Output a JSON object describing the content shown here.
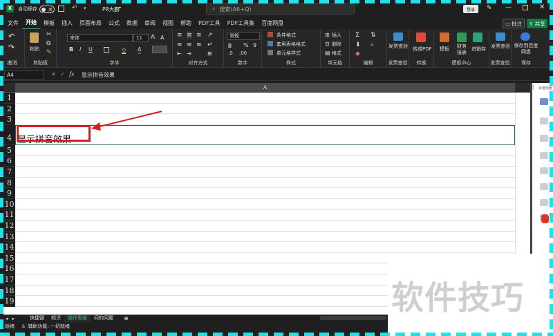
{
  "title_bar": {
    "autosave_label": "自动保存",
    "autosave_state": "关",
    "file_name": "PR大鹏",
    "search_placeholder": "搜索(Alt+Q)",
    "login_label": "登录"
  },
  "menu": [
    "文件",
    "开始",
    "模板",
    "插入",
    "页面布局",
    "公式",
    "数据",
    "审阅",
    "视图",
    "帮助",
    "PDF工具",
    "PDF工具集",
    "百度网盘"
  ],
  "active_menu": "开始",
  "header_buttons": {
    "comment": "批注",
    "share": "共享"
  },
  "ribbon": {
    "undo_label": "撤消",
    "clipboard_label": "剪贴板",
    "paste_label": "粘贴",
    "font_label": "字体",
    "font_name": "宋体",
    "font_size": "11",
    "alignment_label": "对齐方式",
    "number_label": "数字",
    "number_format": "常规",
    "styles_label": "样式",
    "style_items": [
      "条件格式",
      "套用表格格式",
      "单元格样式"
    ],
    "cells_label": "单元格",
    "cell_items": [
      "插入",
      "删除",
      "格式"
    ],
    "edit_label": "编辑",
    "invoice_label": "发票查验",
    "invoice_btn": "发票查验",
    "convert_label": "转换",
    "convert_btn": "转成PDF",
    "template_center_label": "模板中心",
    "template_btn": "模板",
    "finance_btn": "财务报表",
    "sales_btn": "进销存",
    "invoice2_label": "发票查验",
    "invoice2_btn": "发票查验",
    "save_label": "保存",
    "save_btn": "保存到百度网盘"
  },
  "formula_bar": {
    "name_box": "A4",
    "formula": "显示拼音效果"
  },
  "sheet": {
    "column": "A",
    "rows": [
      "1",
      "2",
      "3",
      "4",
      "5",
      "6",
      "7",
      "8",
      "9",
      "10",
      "11",
      "12",
      "13",
      "14",
      "15",
      "16",
      "17",
      "18",
      "19"
    ],
    "cell_a4": "显示拼音效果"
  },
  "tabs": [
    "快捷键",
    "知识",
    "操作思维",
    "问的问题"
  ],
  "active_tab": "操作思维",
  "status": {
    "ready": "就绪",
    "accessibility": "辅助功能: 一切就绪"
  },
  "right_panel": {
    "title": "百度网盘"
  },
  "watermark": "软件技巧",
  "colors": {
    "accent": "#107c41",
    "highlight": "#d11f1f",
    "border_dash": "#22e0e8"
  }
}
